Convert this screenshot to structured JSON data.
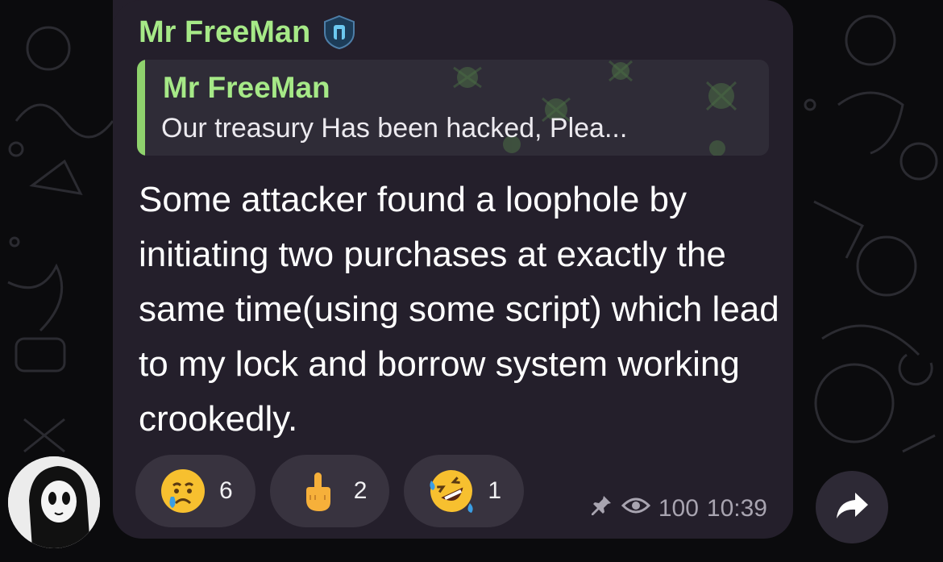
{
  "message": {
    "sender_name": "Mr FreeMan",
    "sender_badge_icon": "shield-badge-icon",
    "reply": {
      "name": "Mr FreeMan",
      "text": "Our treasury Has been hacked, Plea..."
    },
    "body": "Some attacker found a loophole by initiating two purchases at exactly the same time(using some script) which lead to my lock and borrow system working crookedly.",
    "reactions": [
      {
        "emoji": "crying-face-icon",
        "count": "6"
      },
      {
        "emoji": "middle-finger-icon",
        "count": "2"
      },
      {
        "emoji": "rolling-on-floor-laughing-icon",
        "count": "1"
      }
    ],
    "views": "100",
    "time": "10:39"
  },
  "colors": {
    "accent": "#a6e987",
    "bubble": "#241f2b",
    "reaction_bg": "#38333f",
    "meta_text": "#a8a4b0"
  }
}
